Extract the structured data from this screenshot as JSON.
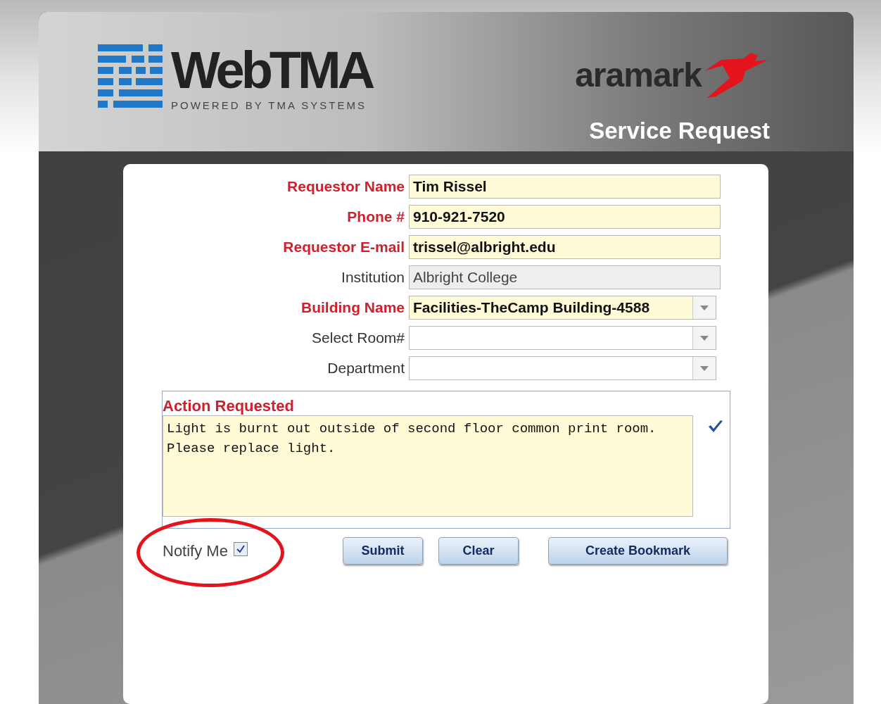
{
  "header": {
    "product_logo": "WebTMA",
    "product_tagline": "POWERED BY TMA SYSTEMS",
    "partner_logo": "aramark",
    "page_title": "Service Request"
  },
  "fields": [
    {
      "label": "Requestor Name",
      "kind": "text",
      "required": true,
      "value": "Tim Rissel"
    },
    {
      "label": "Phone #",
      "kind": "text",
      "required": true,
      "value": "910-921-7520"
    },
    {
      "label": "Requestor E-mail",
      "kind": "text",
      "required": true,
      "value": "trissel@albright.edu"
    },
    {
      "label": "Institution",
      "kind": "readonly",
      "required": false,
      "value": "Albright College"
    },
    {
      "label": "Building Name",
      "kind": "select",
      "required": true,
      "value": "Facilities-TheCamp Building-4588"
    },
    {
      "label": "Select Room#",
      "kind": "select",
      "required": false
    },
    {
      "label": "Department",
      "kind": "select",
      "required": false
    }
  ],
  "action_requested": {
    "label": "Action Requested",
    "value": "Light is burnt out outside of second floor common print room.\nPlease replace light."
  },
  "notify_me": {
    "label": "Notify Me",
    "checked": true,
    "highlighted": true
  },
  "buttons": [
    "Submit",
    "Clear",
    "Create Bookmark"
  ]
}
